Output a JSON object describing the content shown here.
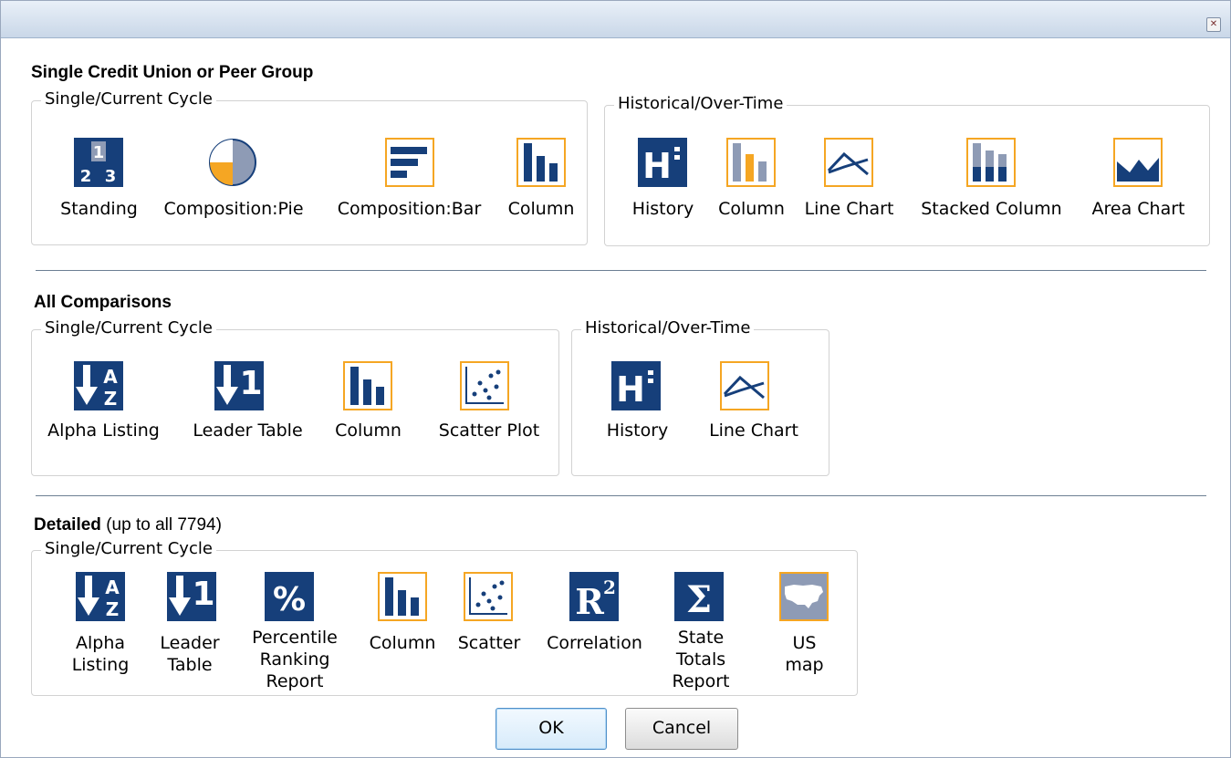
{
  "window": {
    "close_glyph": "✕"
  },
  "sections": {
    "single": {
      "title": "Single Credit Union or Peer Group"
    },
    "comparisons": {
      "title": "All Comparisons"
    },
    "detailed": {
      "title": "Detailed",
      "note": "(up to all 7794)"
    }
  },
  "groups": {
    "s1": {
      "legend": "Single/Current Cycle",
      "items": [
        "Standing",
        "Composition:Pie",
        "Composition:Bar",
        "Column"
      ]
    },
    "s2": {
      "legend": "Historical/Over-Time",
      "items": [
        "History",
        "Column",
        "Line Chart",
        "Stacked Column",
        "Area Chart"
      ]
    },
    "c1": {
      "legend": "Single/Current Cycle",
      "items": [
        "Alpha Listing",
        "Leader Table",
        "Column",
        "Scatter Plot"
      ]
    },
    "c2": {
      "legend": "Historical/Over-Time",
      "items": [
        "History",
        "Line Chart"
      ]
    },
    "d1": {
      "legend": "Single/Current Cycle",
      "items": [
        [
          "Alpha",
          "Listing"
        ],
        [
          "Leader",
          "Table"
        ],
        [
          "Percentile",
          "Ranking",
          "Report"
        ],
        [
          "Column"
        ],
        [
          "Scatter"
        ],
        [
          "Correlation"
        ],
        [
          "State",
          "Totals",
          "Report"
        ],
        [
          "US",
          "map"
        ]
      ]
    }
  },
  "icons": {
    "standing": "standing-icon",
    "pie": "pie-chart-icon",
    "bar": "bar-chart-icon",
    "column": "column-chart-icon",
    "history": "history-icon",
    "line": "line-chart-icon",
    "stacked": "stacked-column-icon",
    "area": "area-chart-icon",
    "alpha": "alpha-sort-icon",
    "leader": "leader-table-icon",
    "scatter": "scatter-plot-icon",
    "percentile": "percentile-icon",
    "correlation": "correlation-icon",
    "sum": "sigma-icon",
    "usmap": "us-map-icon"
  },
  "colors": {
    "navy": "#163f7a",
    "orange": "#f5a623",
    "gray": "#8e9bb5",
    "divider": "#6c7f93"
  },
  "buttons": {
    "ok": "OK",
    "cancel": "Cancel"
  }
}
